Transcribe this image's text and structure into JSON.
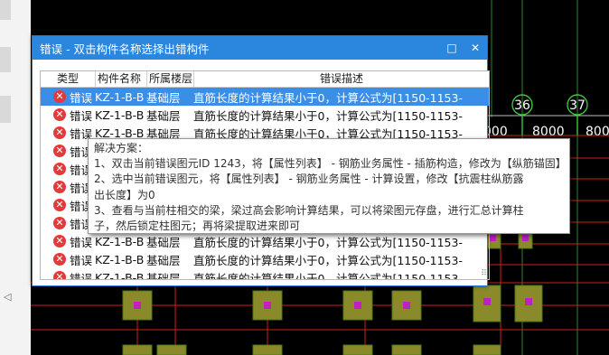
{
  "canvas": {
    "axis_labels": [
      "36",
      "37"
    ],
    "dims": [
      "000",
      "8000",
      "800"
    ]
  },
  "dialog": {
    "title": "错误 - 双击构件名称选择出错构件",
    "maximize_icon": "□",
    "close_icon": "✕",
    "columns": [
      "类型",
      "构件名称",
      "所属楼层",
      "错误描述"
    ],
    "rows": [
      {
        "type": "错误",
        "name": "KZ-1-B-B",
        "floor": "基础层",
        "desc": "直筋长度的计算结果小于0，计算公式为[1150-1153-",
        "selected": true
      },
      {
        "type": "错误",
        "name": "KZ-1-B-B",
        "floor": "基础层",
        "desc": "直筋长度的计算结果小于0，计算公式为[1150-1153-"
      },
      {
        "type": "错误",
        "name": "KZ-1-B-B",
        "floor": "基础层",
        "desc": "直筋长度的计算结果小于0，计算公式为[1150-1153-"
      },
      {
        "type": "错误",
        "name": "",
        "floor": "",
        "desc": ""
      },
      {
        "type": "错误",
        "name": "",
        "floor": "",
        "desc": ""
      },
      {
        "type": "错误",
        "name": "",
        "floor": "",
        "desc": ""
      },
      {
        "type": "错误",
        "name": "",
        "floor": "",
        "desc": ""
      },
      {
        "type": "错误",
        "name": "",
        "floor": "",
        "desc": ""
      },
      {
        "type": "错误",
        "name": "KZ-1-B-B",
        "floor": "基础层",
        "desc": "直筋长度的计算结果小于0，计算公式为[1150-1153-"
      },
      {
        "type": "错误",
        "name": "KZ-1-B-B",
        "floor": "基础层",
        "desc": "直筋长度的计算结果小于0，计算公式为[1150-1153-"
      },
      {
        "type": "错误",
        "name": "KZ-1-B-B",
        "floor": "基础层",
        "desc": "直筋长度的计算结果小于0，计算公式为[1150-1153-"
      }
    ]
  },
  "tooltip": {
    "lines": [
      "解决方案：",
      "1、双击当前错误图元ID 1243，将【属性列表】 - 钢筋业务属性 - 插筋构造，修改为【纵筋锚固】",
      "2、选中当前错误图元，将【属性列表】 - 钢筋业务属性 - 计算设置，修改【抗震柱纵筋露",
      "出长度】为0",
      "3、查看与当前柱相交的梁，梁过高会影响计算结果，可以将梁图元存盘，进行汇总计算柱",
      "子，然后锁定柱图元；再将梁提取进来即可"
    ]
  },
  "left_panel": {
    "mark": "◁"
  },
  "colors": {
    "title_bar": "#2b87dd",
    "selection": "#3b8ee8",
    "error_icon": "#e23a3a",
    "cad_green": "#3cc43c",
    "column_fill": "#8a8a2a",
    "column_core": "#c020c0"
  }
}
